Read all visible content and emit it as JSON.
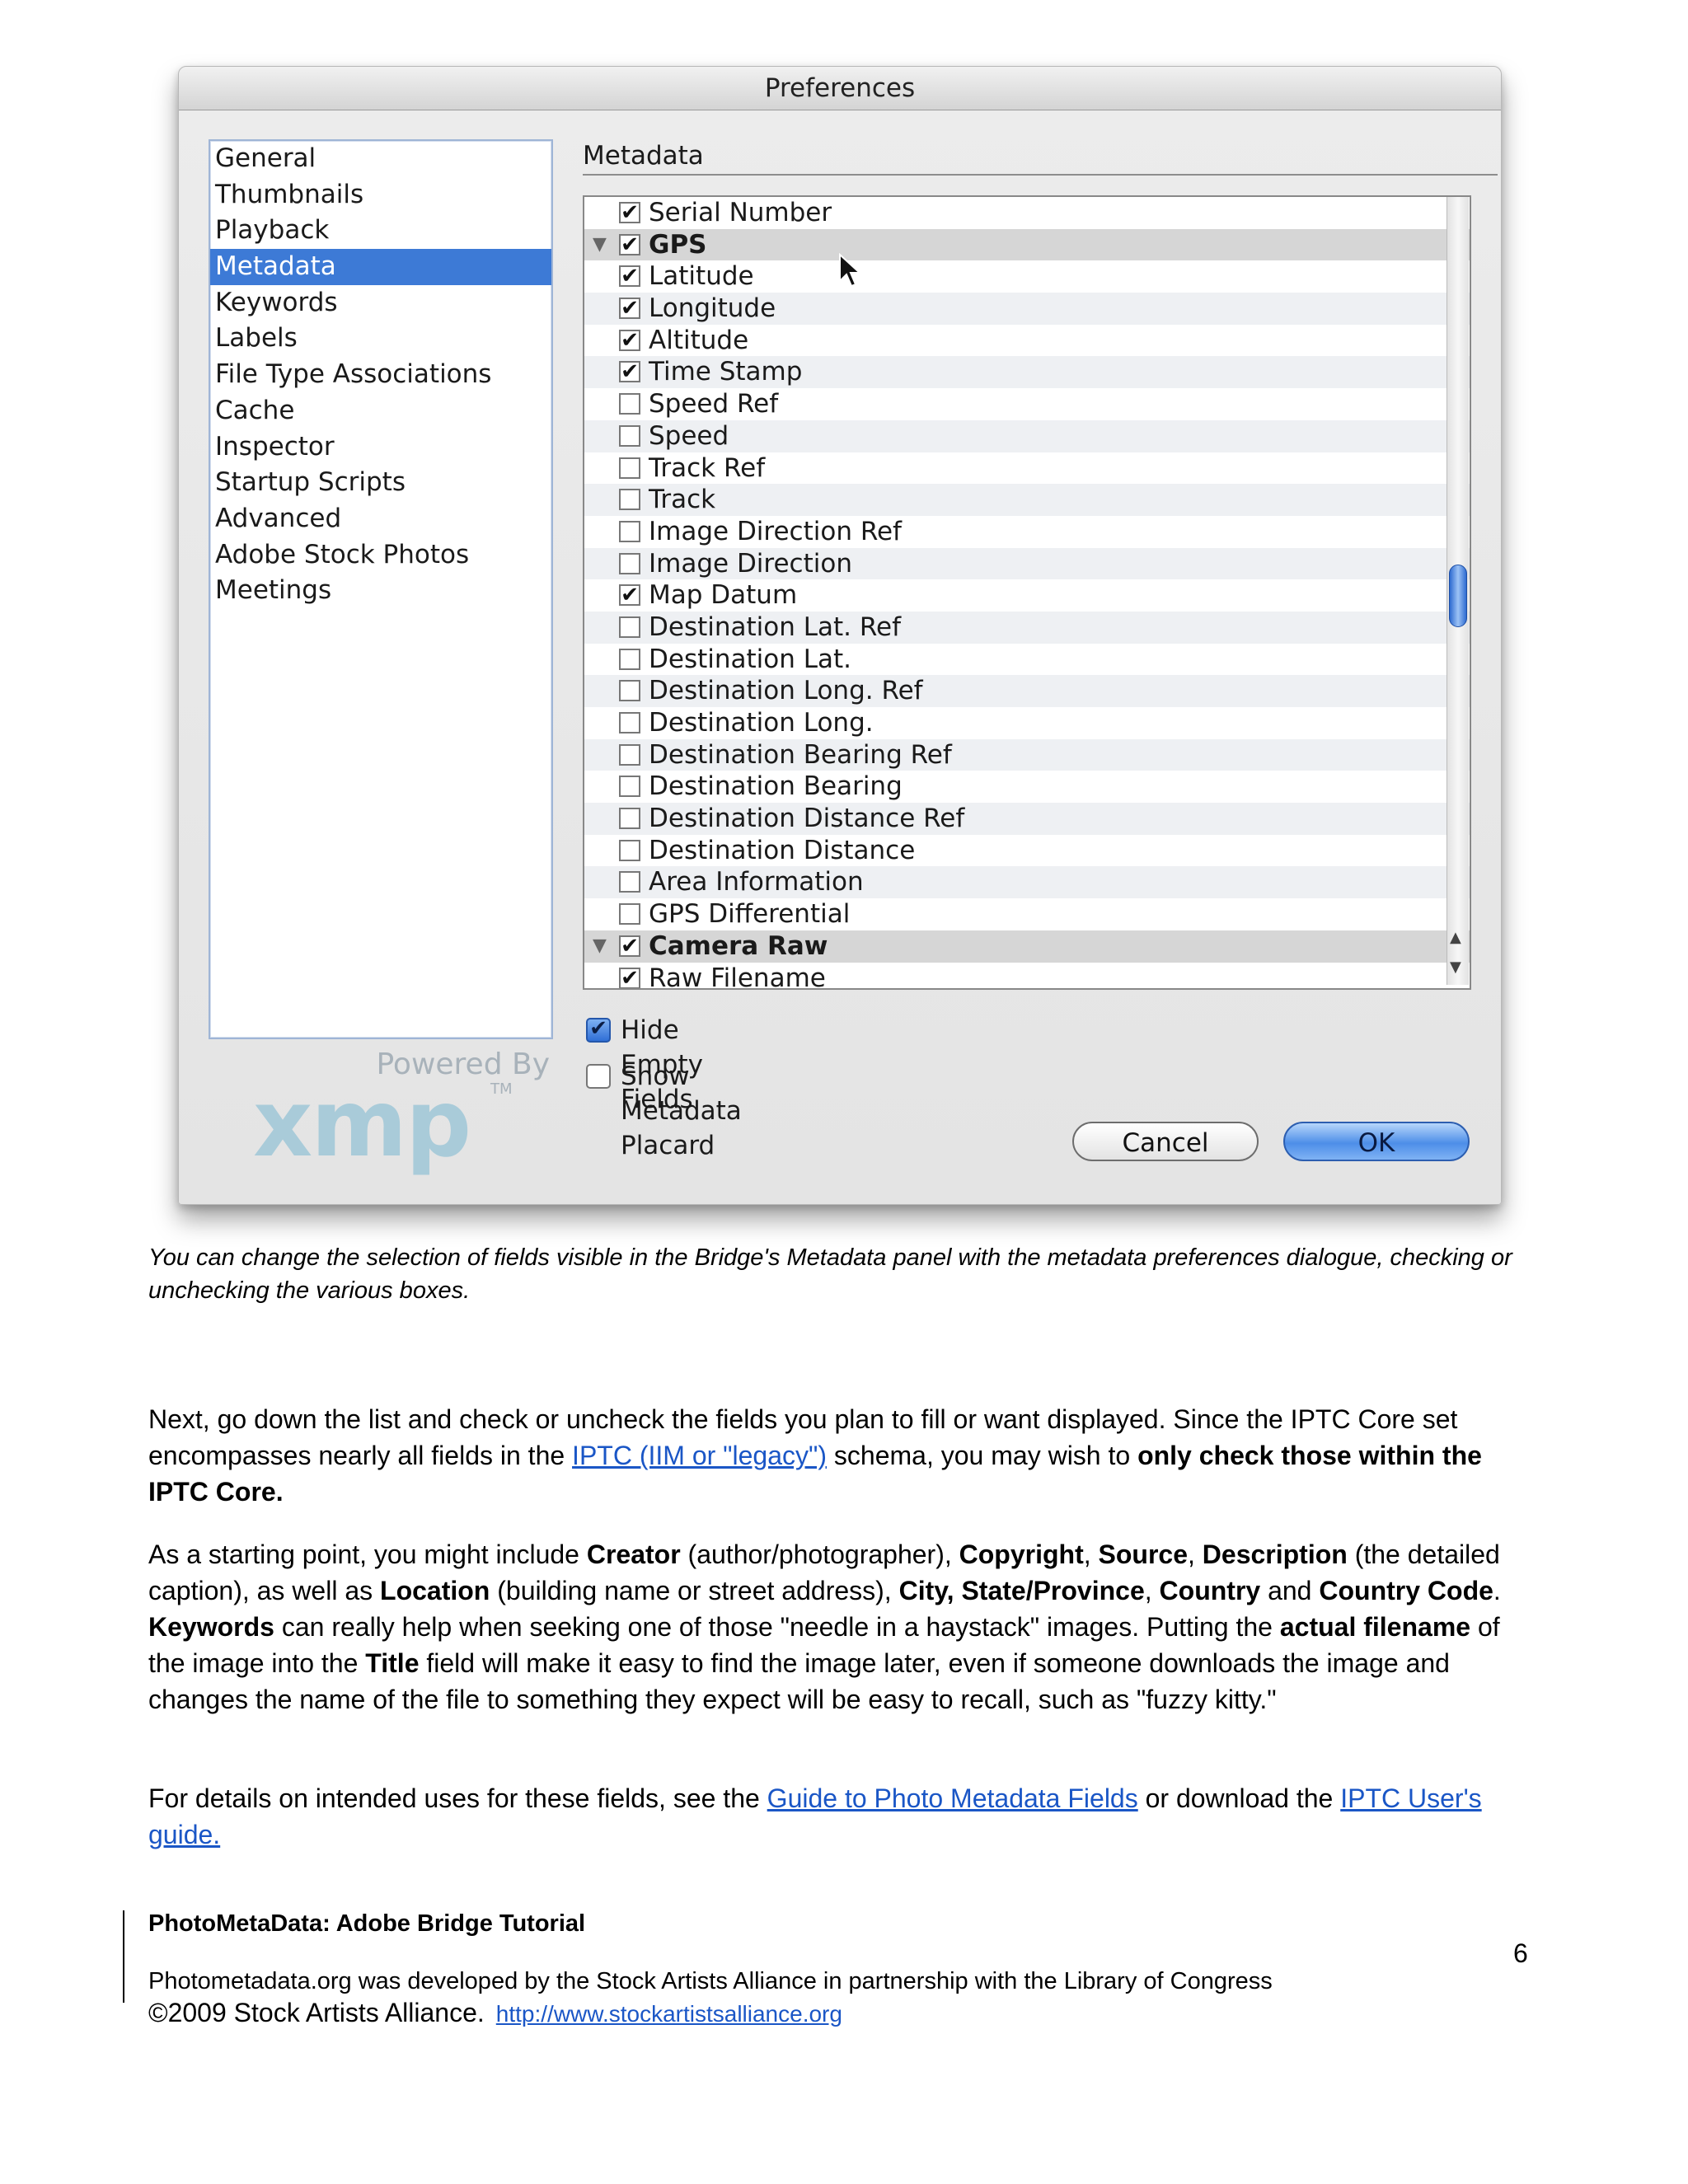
{
  "dialog": {
    "title": "Preferences",
    "categories": [
      {
        "label": "General",
        "selected": false
      },
      {
        "label": "Thumbnails",
        "selected": false
      },
      {
        "label": "Playback",
        "selected": false
      },
      {
        "label": "Metadata",
        "selected": true
      },
      {
        "label": "Keywords",
        "selected": false
      },
      {
        "label": "Labels",
        "selected": false
      },
      {
        "label": "File Type Associations",
        "selected": false
      },
      {
        "label": "Cache",
        "selected": false
      },
      {
        "label": "Inspector",
        "selected": false
      },
      {
        "label": "Startup Scripts",
        "selected": false
      },
      {
        "label": "Advanced",
        "selected": false
      },
      {
        "label": "Adobe Stock Photos",
        "selected": false
      },
      {
        "label": "Meetings",
        "selected": false
      }
    ],
    "logo": {
      "powered_by": "Powered By",
      "word": "xmp",
      "tm": "TM"
    },
    "panel_heading": "Metadata",
    "fields": [
      {
        "label": "Serial Number",
        "checked": true,
        "group": false
      },
      {
        "label": "GPS",
        "checked": true,
        "group": true
      },
      {
        "label": "Latitude",
        "checked": true,
        "group": false
      },
      {
        "label": "Longitude",
        "checked": true,
        "group": false
      },
      {
        "label": "Altitude",
        "checked": true,
        "group": false
      },
      {
        "label": "Time Stamp",
        "checked": true,
        "group": false
      },
      {
        "label": "Speed Ref",
        "checked": false,
        "group": false
      },
      {
        "label": "Speed",
        "checked": false,
        "group": false
      },
      {
        "label": "Track Ref",
        "checked": false,
        "group": false
      },
      {
        "label": "Track",
        "checked": false,
        "group": false
      },
      {
        "label": "Image Direction Ref",
        "checked": false,
        "group": false
      },
      {
        "label": "Image Direction",
        "checked": false,
        "group": false
      },
      {
        "label": "Map Datum",
        "checked": true,
        "group": false
      },
      {
        "label": "Destination Lat. Ref",
        "checked": false,
        "group": false
      },
      {
        "label": "Destination Lat.",
        "checked": false,
        "group": false
      },
      {
        "label": "Destination Long. Ref",
        "checked": false,
        "group": false
      },
      {
        "label": "Destination Long.",
        "checked": false,
        "group": false
      },
      {
        "label": "Destination Bearing Ref",
        "checked": false,
        "group": false
      },
      {
        "label": "Destination Bearing",
        "checked": false,
        "group": false
      },
      {
        "label": "Destination Distance Ref",
        "checked": false,
        "group": false
      },
      {
        "label": "Destination Distance",
        "checked": false,
        "group": false
      },
      {
        "label": "Area Information",
        "checked": false,
        "group": false
      },
      {
        "label": "GPS Differential",
        "checked": false,
        "group": false
      },
      {
        "label": "Camera Raw",
        "checked": true,
        "group": true
      },
      {
        "label": "Raw Filename",
        "checked": true,
        "group": false
      }
    ],
    "options": {
      "hide_empty": {
        "label": "Hide Empty Fields",
        "checked": true
      },
      "show_placard": {
        "label": "Show Metadata Placard",
        "checked": false
      }
    },
    "buttons": {
      "cancel": "Cancel",
      "ok": "OK"
    },
    "check_glyph": "✔",
    "twisty_glyph": "▼"
  },
  "caption": "You can change the selection of fields visible in the Bridge's Metadata panel with the metadata preferences dialogue, checking or unchecking the various boxes.",
  "para1": {
    "t1": "Next, go down the list and check or uncheck the fields you plan to fill or want displayed. Since the IPTC Core set encompasses nearly all fields in the ",
    "link": "IPTC (IIM or \"legacy\")",
    "t2": " schema, you may wish to ",
    "b1": "only check those within the IPTC Core."
  },
  "para2": {
    "t1": "As a starting point, you might include ",
    "b_creator": "Creator",
    "t2": " (author/photographer), ",
    "b_copyright": "Copyright",
    "t3": ", ",
    "b_source": "Source",
    "t4": ", ",
    "b_description": "Description",
    "t5": " (the detailed caption), as well as ",
    "b_location": "Location",
    "t6": " (building name or street address), ",
    "b_city": "City, State/Province",
    "t7": ", ",
    "b_country": "Country",
    "t8": " and ",
    "b_country_code": "Country Code",
    "t9": ". ",
    "b_keywords": "Keywords",
    "t10": " can really help when seeking one of those \"needle in a haystack\" images. Putting the ",
    "b_filename": "actual filename",
    "t11": " of the image into the ",
    "b_title": "Title",
    "t12": " field will make it easy to find the image later, even if someone downloads the image and changes the name of the file to something they expect will be easy to recall, such as \"fuzzy kitty.\""
  },
  "para3": {
    "t1": "For details on intended uses for these fields, see the ",
    "link1": "Guide to Photo Metadata Fields",
    "t2": " or download the ",
    "link2": "IPTC User's guide."
  },
  "footer": {
    "title": "PhotoMetaData: Adobe Bridge Tutorial",
    "page_number": "6",
    "credit": "Photometadata.org was developed by the Stock Artists Alliance in partnership with the Library of Congress",
    "copyright": "©2009 Stock Artists Alliance.",
    "url": "http://www.stockartistsalliance.org"
  }
}
